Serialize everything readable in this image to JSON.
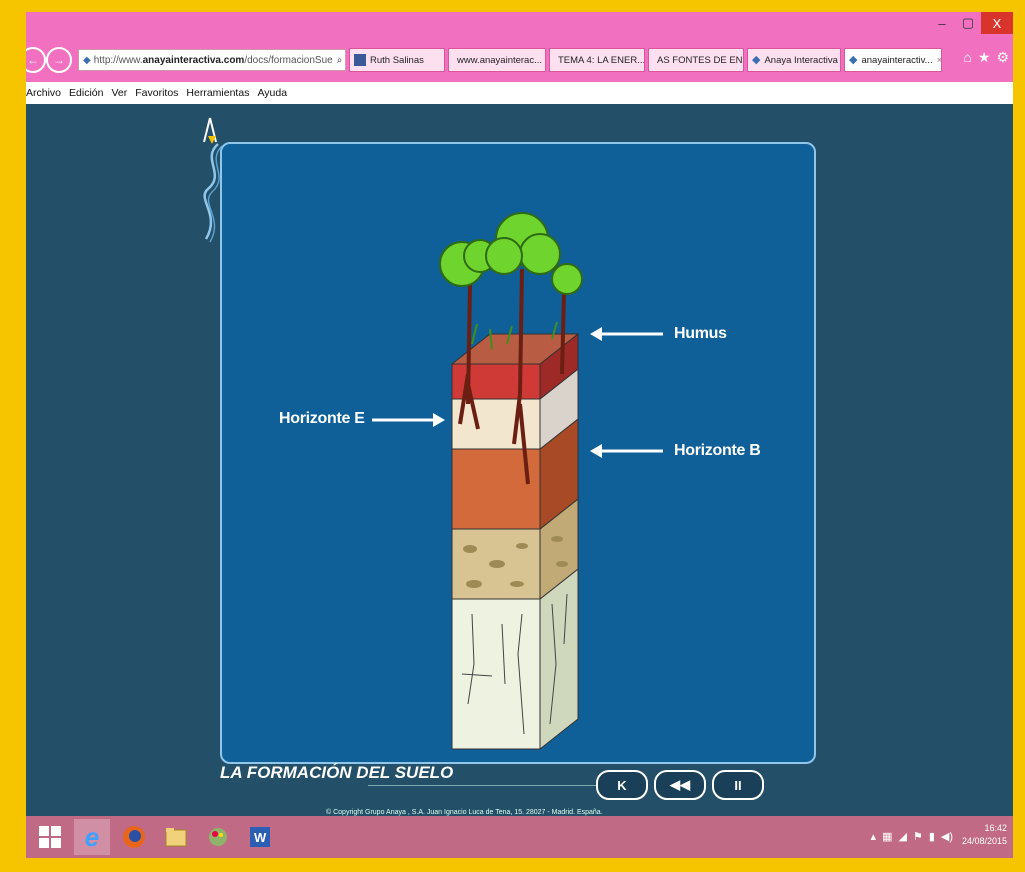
{
  "browser": {
    "window_controls": [
      "–",
      "▢",
      "X"
    ],
    "address_prefix": "http://www.",
    "address_domain": "anayainteractiva.com",
    "address_rest": "/docs/formacionSue",
    "address_buttons": "⌕ ▾ C",
    "tabs": [
      {
        "label": "Ruth Salinas",
        "icon_color": "#3b5998",
        "active": false
      },
      {
        "label": "www.anayainterac...",
        "icon_color": "#4285f4",
        "active": false
      },
      {
        "label": "TEMA 4: LA ENER...",
        "icon_color": "#4a7a2c",
        "active": false
      },
      {
        "label": "AS FONTES DE EN...",
        "icon_color": "#4a7a2c",
        "active": false
      },
      {
        "label": "Anaya Interactiva",
        "icon_color": "#3b6fb0",
        "active": false
      },
      {
        "label": "anayainteractiv...",
        "icon_color": "#3b6fb0",
        "active": true
      }
    ],
    "tab_close": "×",
    "menu": [
      "Archivo",
      "Edición",
      "Ver",
      "Favoritos",
      "Herramientas",
      "Ayuda"
    ]
  },
  "content": {
    "labels": {
      "humus": "Humus",
      "horizonte_e": "Horizonte E",
      "horizonte_b": "Horizonte B"
    },
    "title": "LA FORMACIÓN DEL SUELO",
    "controls": [
      "K",
      "◀◀",
      "II"
    ],
    "copyright": "© Copyright Grupo Anaya , S.A. Juan Ignacio Luca de Tena, 15. 28027 - Madrid. España."
  },
  "taskbar": {
    "time": "16:42",
    "date": "24/08/2015"
  },
  "colors": {
    "frame": "#f7c400",
    "browser_chrome": "#f270c0",
    "stage_bg": "#0f5f98",
    "page_bg": "#244f69",
    "taskbar": "#c06a86"
  }
}
